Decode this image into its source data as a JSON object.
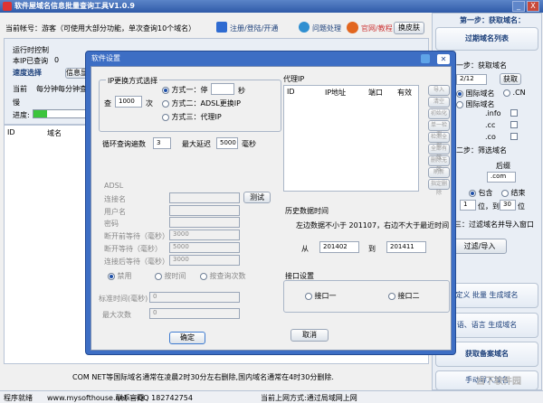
{
  "window": {
    "title": "软件屋域名信息批量查询工具V1.0.9",
    "min": "_",
    "close": "X"
  },
  "topbar": {
    "account": "当前帐号：游客（可使用大部分功能，单次查询10个域名）",
    "login": "注册/登陆/开通",
    "faq": "问题处理",
    "site": "官网/教程",
    "skin": "换皮肤"
  },
  "status": {
    "run_control": "运行时控制",
    "ip_query": "本IP已查询",
    "ip_count": "0",
    "speed": "速度选择",
    "info": "信息显",
    "current": "当前",
    "rate": "每分钟每分钟查询15",
    "slow": "慢",
    "progress_label": "进度:",
    "progress_value": 0.25
  },
  "table": {
    "col_id": "ID",
    "col_domain": "域名"
  },
  "right": {
    "head": "第一步：获取域名：",
    "tab": "过期域名列表",
    "step1": "一步：获取域名",
    "date": "2/12",
    "fetch": "获取",
    "intl": "国际域名",
    ".cn": ".CN",
    "opt_intl2": "国际域名",
    ".info": ".info",
    ".cc": ".cc",
    ".co": ".co",
    "filter_step": "二步：筛选域名",
    "ge": "后缀",
    "suffix": ".com",
    "yes": "包含",
    "no": "结束",
    "n1": "1",
    "pos_label": "位，到",
    "n30": "30",
    "pos_end": "位",
    "step3": "三：过滤域名并导入窗口",
    "filter_btn": "过滤/导入",
    "custom1": "定义 批量 生成域名",
    "custom2": "语、语言 生成域名",
    "beian": "获取备案域名",
    "manual": "手动导入域名"
  },
  "footer": {
    "notice": "COM NET等国际域名通常在凌晨2时30分左右删除,国内域名通常在4时30分删除.",
    "ready": "程序就绪",
    "url": "www.mysofthouse.net 官网",
    "qq": "联系—QQ 182742754",
    "ip": "当前上网方式:通过局域网上网"
  },
  "dialog": {
    "title": "软件设置",
    "ip_group": "IP更换方式选择",
    "query_label": "查",
    "query_value": "1000",
    "query_unit": "次",
    "mode1": "方式一：停",
    "mode1_unit": "秒",
    "mode2": "方式二：ADSL更换IP",
    "mode3": "方式三：代理IP",
    "loop_label": "循环查询遍数",
    "loop_value": "3",
    "delay_label": "最大延迟",
    "delay_value": "5000",
    "delay_unit": "毫秒",
    "adsl_group": "ADSL",
    "conn_label": "连接名",
    "test_btn": "测试",
    "user_label": "用户名",
    "pwd_label": "密码",
    "wait1_label": "断开前等待（毫秒）",
    "wait1_value": "3000",
    "wait2_label": "断开等待（毫秒）",
    "wait2_value": "5000",
    "wait3_label": "连接后等待（毫秒）",
    "wait3_value": "3000",
    "opt_disable": "禁用",
    "opt_time": "按时间",
    "opt_count": "按查询次数",
    "std_time_label": "标准时间(毫秒)",
    "std_time_value": "0",
    "max_count_label": "最大次数",
    "max_count_value": "0",
    "proxy_group": "代理IP",
    "proxy_cols": [
      "ID",
      "IP地址",
      "端口",
      "有效"
    ],
    "proxy_btns": [
      "导入",
      "清空",
      "初始化",
      "单一检测",
      "检测全部",
      "全部有效",
      "删除无效",
      "刷新",
      "指定删除"
    ],
    "history_group": "历史数据时间",
    "history_desc": "左边数据不小于 201107，右边不大于最近时间",
    "from_label": "从",
    "from_value": "201402",
    "to_label": "到",
    "to_value": "201411",
    "port_group": "接口设置",
    "port1": "接口一",
    "port2": "接口二",
    "ok": "确定",
    "cancel": "取消"
  },
  "watermark": "当下软件园"
}
